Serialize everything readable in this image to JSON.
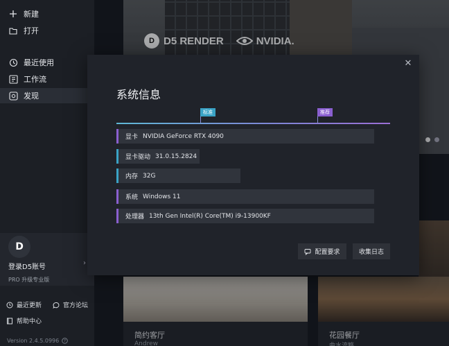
{
  "sidebar": {
    "new_label": "新建",
    "open_label": "打开",
    "recent_label": "最近使用",
    "workflow_label": "工作流",
    "discover_label": "发现",
    "avatar_initial": "D",
    "login_label": "登录D5账号",
    "pro_label": "PRO 升级专业版",
    "updates_label": "最近更新",
    "forum_label": "官方论坛",
    "help_label": "帮助中心",
    "version": "Version 2.4.5.0996"
  },
  "banner": {
    "d5_brand": "D5 RENDER",
    "nvidia_brand": "NVIDIA."
  },
  "cards": [
    {
      "title": "简约客厅",
      "author": "Andrew"
    },
    {
      "title": "花园餐厅",
      "author": "曲水流觞"
    }
  ],
  "modal": {
    "title": "系统信息",
    "tag_standard": "标准",
    "tag_recommended": "推荐",
    "specs": [
      {
        "label": "显卡",
        "value": "NVIDIA GeForce RTX 4090"
      },
      {
        "label": "显卡驱动",
        "value": "31.0.15.2824"
      },
      {
        "label": "内存",
        "value": "32G"
      },
      {
        "label": "系统",
        "value": "Windows 11"
      },
      {
        "label": "处理器",
        "value": "13th Gen Intel(R) Core(TM) i9-13900KF"
      }
    ],
    "config_button": "配置要求",
    "log_button": "收集日志"
  },
  "colors": {
    "standard_accent": "#3aa3c6",
    "recommended_accent": "#8a5fd0",
    "modal_bg": "#20232a"
  }
}
